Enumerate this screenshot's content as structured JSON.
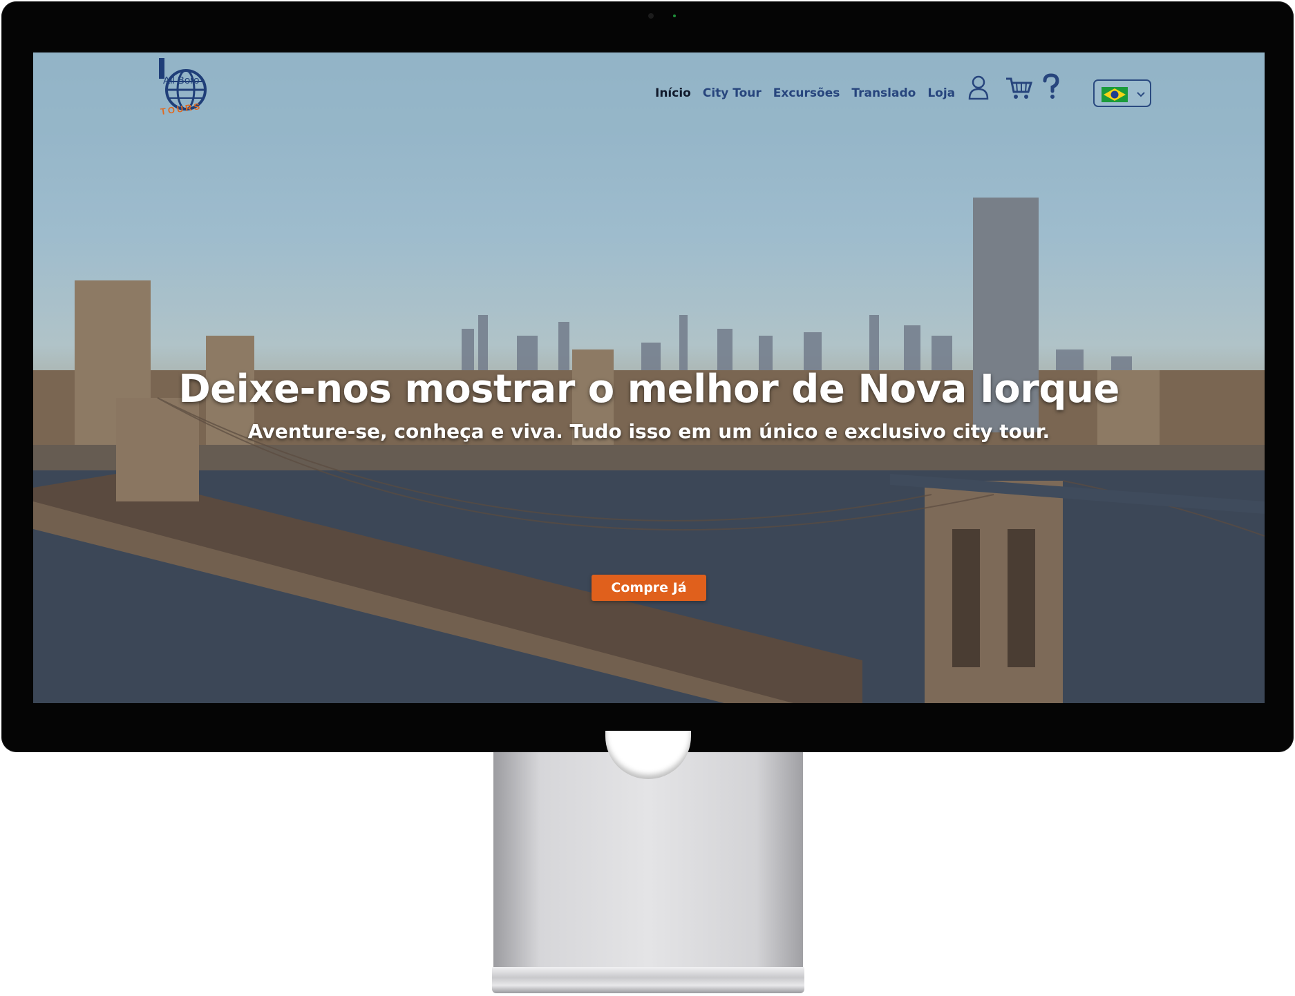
{
  "brand": {
    "logo_text": "All Boro",
    "logo_sub": "TOURS"
  },
  "nav": {
    "items": [
      {
        "label": "Início",
        "active": true
      },
      {
        "label": "City Tour"
      },
      {
        "label": "Excursões"
      },
      {
        "label": "Translado"
      },
      {
        "label": "Loja"
      }
    ],
    "icons": [
      "user-icon",
      "cart-icon",
      "help-icon"
    ],
    "language": {
      "selected": "Português (Brasil)",
      "icon": "brazil-flag-icon"
    }
  },
  "hero": {
    "title": "Deixe-nos mostrar o melhor de Nova Iorque",
    "subtitle": "Aventure-se, conheça e viva. Tudo isso em um único e exclusivo city tour.",
    "cta_label": "Compre Já"
  },
  "colors": {
    "accent": "#e0601c",
    "nav_text": "#27457d",
    "nav_active": "#111a2c",
    "bezel": "#050505"
  }
}
